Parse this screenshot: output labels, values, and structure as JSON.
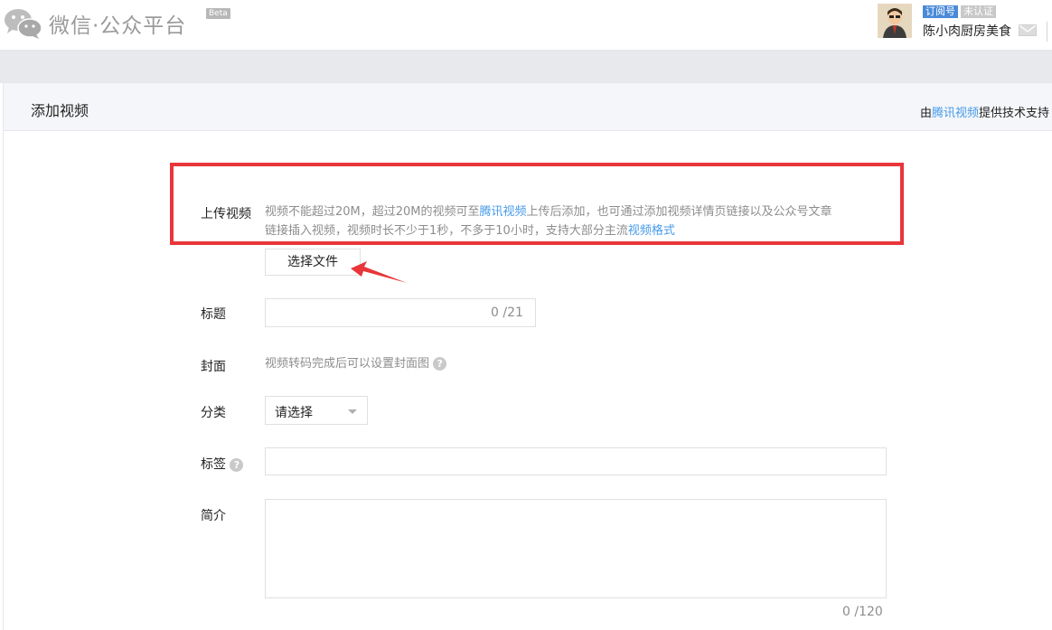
{
  "header": {
    "brand": "微信·公众平台",
    "beta": "Beta",
    "account_type_badge": "订阅号",
    "verify_badge": "未认证",
    "account_name": "陈小肉厨房美食",
    "icons": [
      "wechat-logo-icon",
      "mail-icon"
    ]
  },
  "panel": {
    "title": "添加视频",
    "powered_prefix": "由",
    "powered_link": "腾讯视频",
    "powered_suffix": "提供技术支持"
  },
  "form": {
    "upload": {
      "label": "上传视频",
      "hint_1": "视频不能超过20M，超过20M的视频可至",
      "hint_link_1": "腾讯视频",
      "hint_2": "上传后添加，也可通过添加视频详情页链接以及公众号文章",
      "hint_3": "链接插入视频，视频时长不少于1秒，不多于10小时，支持大部分主流",
      "hint_link_2": "视频格式",
      "button": "选择文件"
    },
    "title": {
      "label": "标题",
      "value": "",
      "counter": "0 /21"
    },
    "cover": {
      "label": "封面",
      "hint": "视频转码完成后可以设置封面图",
      "help": "?"
    },
    "category": {
      "label": "分类",
      "selected": "请选择"
    },
    "tags": {
      "label": "标签",
      "help": "?",
      "value": ""
    },
    "intro": {
      "label": "简介",
      "value": "",
      "counter": "0 /120"
    }
  },
  "colors": {
    "accent_link": "#459ae9",
    "highlight_box": "#e8363a",
    "badge_blue": "#4a8ad8"
  }
}
